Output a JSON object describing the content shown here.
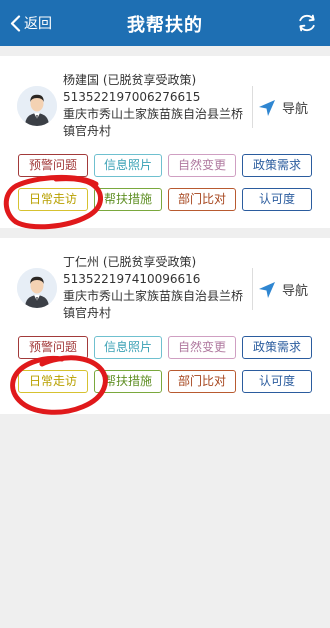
{
  "header": {
    "back_label": "返回",
    "title": "我帮扶的",
    "refresh_icon": "refresh-icon"
  },
  "cards": [
    {
      "name": "杨建国 (已脱贫享受政策)",
      "id_number": "513522197006276615",
      "address": "重庆市秀山土家族苗族自治县兰桥镇官舟村",
      "nav_label": "导航"
    },
    {
      "name": "丁仁州 (已脱贫享受政策)",
      "id_number": "513522197410096616",
      "address": "重庆市秀山土家族苗族自治县兰桥镇官舟村",
      "nav_label": "导航"
    }
  ],
  "tags": {
    "warning": "预警问题",
    "photos": "信息照片",
    "natural_change": "自然变更",
    "policy_needs": "政策需求",
    "daily_visit": "日常走访",
    "assist_measures": "帮扶措施",
    "dept_compare": "部门比对",
    "recognition": "认可度"
  },
  "colors": {
    "header_bg": "#1e6fb3",
    "annotation_red": "#e0191b"
  }
}
